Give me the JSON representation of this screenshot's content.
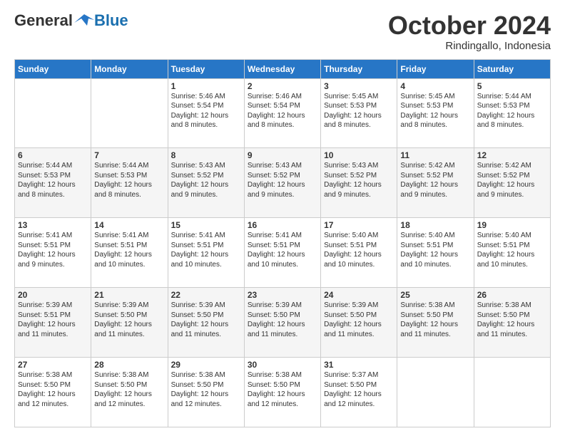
{
  "logo": {
    "general": "General",
    "blue": "Blue"
  },
  "header": {
    "month": "October 2024",
    "location": "Rindingallo, Indonesia"
  },
  "weekdays": [
    "Sunday",
    "Monday",
    "Tuesday",
    "Wednesday",
    "Thursday",
    "Friday",
    "Saturday"
  ],
  "weeks": [
    [
      {
        "day": "",
        "info": ""
      },
      {
        "day": "",
        "info": ""
      },
      {
        "day": "1",
        "info": "Sunrise: 5:46 AM\nSunset: 5:54 PM\nDaylight: 12 hours and 8 minutes."
      },
      {
        "day": "2",
        "info": "Sunrise: 5:46 AM\nSunset: 5:54 PM\nDaylight: 12 hours and 8 minutes."
      },
      {
        "day": "3",
        "info": "Sunrise: 5:45 AM\nSunset: 5:53 PM\nDaylight: 12 hours and 8 minutes."
      },
      {
        "day": "4",
        "info": "Sunrise: 5:45 AM\nSunset: 5:53 PM\nDaylight: 12 hours and 8 minutes."
      },
      {
        "day": "5",
        "info": "Sunrise: 5:44 AM\nSunset: 5:53 PM\nDaylight: 12 hours and 8 minutes."
      }
    ],
    [
      {
        "day": "6",
        "info": "Sunrise: 5:44 AM\nSunset: 5:53 PM\nDaylight: 12 hours and 8 minutes."
      },
      {
        "day": "7",
        "info": "Sunrise: 5:44 AM\nSunset: 5:53 PM\nDaylight: 12 hours and 8 minutes."
      },
      {
        "day": "8",
        "info": "Sunrise: 5:43 AM\nSunset: 5:52 PM\nDaylight: 12 hours and 9 minutes."
      },
      {
        "day": "9",
        "info": "Sunrise: 5:43 AM\nSunset: 5:52 PM\nDaylight: 12 hours and 9 minutes."
      },
      {
        "day": "10",
        "info": "Sunrise: 5:43 AM\nSunset: 5:52 PM\nDaylight: 12 hours and 9 minutes."
      },
      {
        "day": "11",
        "info": "Sunrise: 5:42 AM\nSunset: 5:52 PM\nDaylight: 12 hours and 9 minutes."
      },
      {
        "day": "12",
        "info": "Sunrise: 5:42 AM\nSunset: 5:52 PM\nDaylight: 12 hours and 9 minutes."
      }
    ],
    [
      {
        "day": "13",
        "info": "Sunrise: 5:41 AM\nSunset: 5:51 PM\nDaylight: 12 hours and 9 minutes."
      },
      {
        "day": "14",
        "info": "Sunrise: 5:41 AM\nSunset: 5:51 PM\nDaylight: 12 hours and 10 minutes."
      },
      {
        "day": "15",
        "info": "Sunrise: 5:41 AM\nSunset: 5:51 PM\nDaylight: 12 hours and 10 minutes."
      },
      {
        "day": "16",
        "info": "Sunrise: 5:41 AM\nSunset: 5:51 PM\nDaylight: 12 hours and 10 minutes."
      },
      {
        "day": "17",
        "info": "Sunrise: 5:40 AM\nSunset: 5:51 PM\nDaylight: 12 hours and 10 minutes."
      },
      {
        "day": "18",
        "info": "Sunrise: 5:40 AM\nSunset: 5:51 PM\nDaylight: 12 hours and 10 minutes."
      },
      {
        "day": "19",
        "info": "Sunrise: 5:40 AM\nSunset: 5:51 PM\nDaylight: 12 hours and 10 minutes."
      }
    ],
    [
      {
        "day": "20",
        "info": "Sunrise: 5:39 AM\nSunset: 5:51 PM\nDaylight: 12 hours and 11 minutes."
      },
      {
        "day": "21",
        "info": "Sunrise: 5:39 AM\nSunset: 5:50 PM\nDaylight: 12 hours and 11 minutes."
      },
      {
        "day": "22",
        "info": "Sunrise: 5:39 AM\nSunset: 5:50 PM\nDaylight: 12 hours and 11 minutes."
      },
      {
        "day": "23",
        "info": "Sunrise: 5:39 AM\nSunset: 5:50 PM\nDaylight: 12 hours and 11 minutes."
      },
      {
        "day": "24",
        "info": "Sunrise: 5:39 AM\nSunset: 5:50 PM\nDaylight: 12 hours and 11 minutes."
      },
      {
        "day": "25",
        "info": "Sunrise: 5:38 AM\nSunset: 5:50 PM\nDaylight: 12 hours and 11 minutes."
      },
      {
        "day": "26",
        "info": "Sunrise: 5:38 AM\nSunset: 5:50 PM\nDaylight: 12 hours and 11 minutes."
      }
    ],
    [
      {
        "day": "27",
        "info": "Sunrise: 5:38 AM\nSunset: 5:50 PM\nDaylight: 12 hours and 12 minutes."
      },
      {
        "day": "28",
        "info": "Sunrise: 5:38 AM\nSunset: 5:50 PM\nDaylight: 12 hours and 12 minutes."
      },
      {
        "day": "29",
        "info": "Sunrise: 5:38 AM\nSunset: 5:50 PM\nDaylight: 12 hours and 12 minutes."
      },
      {
        "day": "30",
        "info": "Sunrise: 5:38 AM\nSunset: 5:50 PM\nDaylight: 12 hours and 12 minutes."
      },
      {
        "day": "31",
        "info": "Sunrise: 5:37 AM\nSunset: 5:50 PM\nDaylight: 12 hours and 12 minutes."
      },
      {
        "day": "",
        "info": ""
      },
      {
        "day": "",
        "info": ""
      }
    ]
  ]
}
